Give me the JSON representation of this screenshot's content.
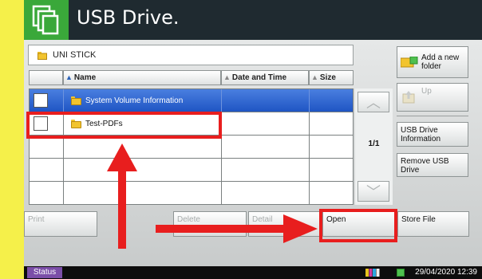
{
  "header": {
    "title": "USB Drive.",
    "app_icon": "copy-files-icon"
  },
  "path": {
    "label": "UNI STICK"
  },
  "columns": {
    "name": "Name",
    "date_time": "Date and Time",
    "size": "Size"
  },
  "files": [
    {
      "name": "System Volume Information",
      "selected": true
    },
    {
      "name": "Test-PDFs",
      "selected": false
    }
  ],
  "pager": {
    "page_indicator": "1/1"
  },
  "sidebar": {
    "add_folder": "Add a new folder",
    "up": "Up",
    "usb_info": "USB Drive Information",
    "remove": "Remove USB Drive"
  },
  "bottom": {
    "print": "Print",
    "delete": "Delete",
    "details": "Detail",
    "open": "Open",
    "store_file": "Store File"
  },
  "status_bar": {
    "status": "Status",
    "datetime": "29/04/2020  12:39"
  },
  "colors": {
    "page_bg": "#f5f04a",
    "header_bg": "#1f2a30",
    "app_icon_bg": "#3aa83a",
    "selected_row": "#2a5fcc",
    "highlight": "#e81e1e",
    "status_btn": "#7b4ea8"
  }
}
